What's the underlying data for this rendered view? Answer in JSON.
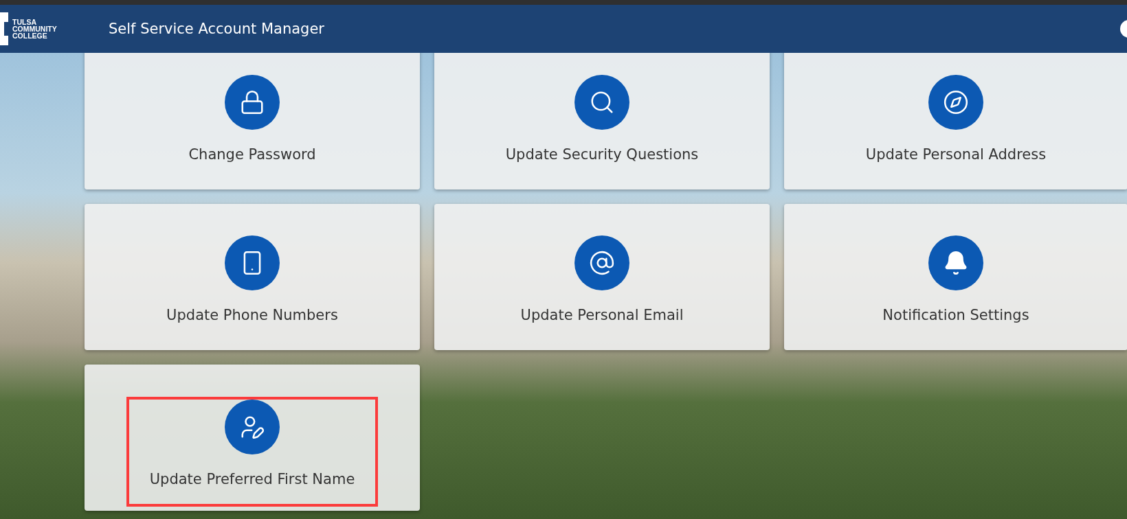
{
  "header": {
    "logo_lines": [
      "TULSA",
      "COMMUNITY",
      "COLLEGE"
    ],
    "title": "Self Service Account Manager"
  },
  "cards": [
    {
      "label": "Change Password",
      "highlighted": false
    },
    {
      "label": "Update Security Questions",
      "highlighted": false
    },
    {
      "label": "Update Personal Address",
      "highlighted": false
    },
    {
      "label": "Update Phone Numbers",
      "highlighted": false
    },
    {
      "label": "Update Personal Email",
      "highlighted": false
    },
    {
      "label": "Notification Settings",
      "highlighted": false
    },
    {
      "label": "Update Preferred First Name",
      "highlighted": true
    }
  ]
}
